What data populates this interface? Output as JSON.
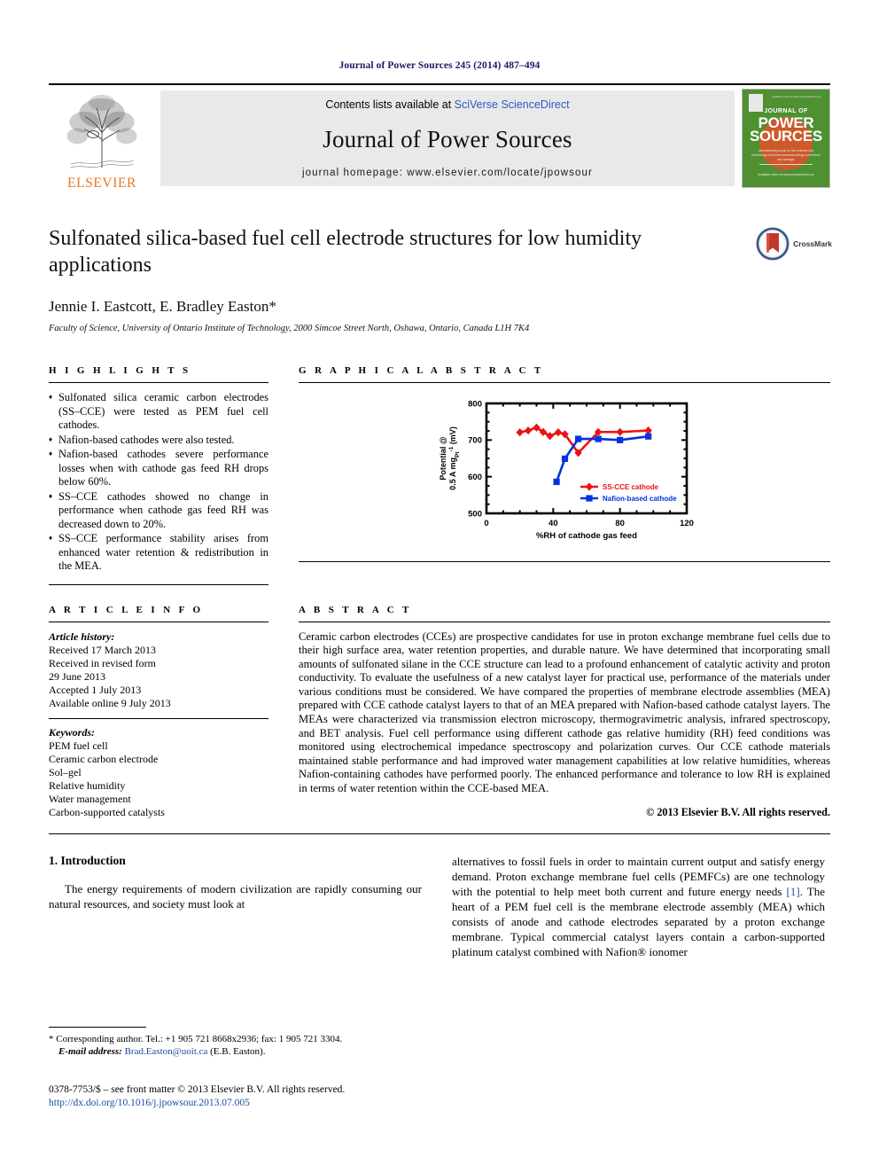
{
  "running_head": "Journal of Power Sources 245 (2014) 487–494",
  "masthead": {
    "contents_prefix": "Contents lists available at ",
    "contents_link": "SciVerse ScienceDirect",
    "journal_name": "Journal of Power Sources",
    "homepage": "journal homepage: www.elsevier.com/locate/jpowsour",
    "publisher": "ELSEVIER",
    "cover": {
      "line1": "JOURNAL OF",
      "line2": "POWER",
      "line3": "SOURCES",
      "subtitle": "International journal on the science and technology of electrochemical energy conversion and storage",
      "footer": "Available online at www.sciencedirect.com"
    }
  },
  "title": "Sulfonated silica-based fuel cell electrode structures for low humidity applications",
  "authors": "Jennie I. Eastcott, E. Bradley Easton*",
  "affiliation": "Faculty of Science, University of Ontario Institute of Technology, 2000 Simcoe Street North, Oshawa, Ontario, Canada L1H 7K4",
  "crossmark_label": "CrossMark",
  "highlights": {
    "heading": "H I G H L I G H T S",
    "items": [
      "Sulfonated silica ceramic carbon electrodes (SS–CCE) were tested as PEM fuel cell cathodes.",
      "Nafion-based cathodes were also tested.",
      "Nafion-based cathodes severe performance losses when with cathode gas feed RH drops below 60%.",
      "SS–CCE cathodes showed no change in performance when cathode gas feed RH was decreased down to 20%.",
      "SS–CCE performance stability arises from enhanced water retention & redistribution in the MEA."
    ]
  },
  "graphical_abstract": {
    "heading": "G R A P H I C A L   A B S T R A C T"
  },
  "article_info": {
    "heading": "A R T I C L E   I N F O",
    "history_title": "Article history:",
    "history": [
      "Received 17 March 2013",
      "Received in revised form",
      "29 June 2013",
      "Accepted 1 July 2013",
      "Available online 9 July 2013"
    ],
    "keywords_title": "Keywords:",
    "keywords": [
      "PEM fuel cell",
      "Ceramic carbon electrode",
      "Sol–gel",
      "Relative humidity",
      "Water management",
      "Carbon-supported catalysts"
    ]
  },
  "abstract": {
    "heading": "A B S T R A C T",
    "text": "Ceramic carbon electrodes (CCEs) are prospective candidates for use in proton exchange membrane fuel cells due to their high surface area, water retention properties, and durable nature. We have determined that incorporating small amounts of sulfonated silane in the CCE structure can lead to a profound enhancement of catalytic activity and proton conductivity. To evaluate the usefulness of a new catalyst layer for practical use, performance of the materials under various conditions must be considered. We have compared the properties of membrane electrode assemblies (MEA) prepared with CCE cathode catalyst layers to that of an MEA prepared with Nafion-based cathode catalyst layers. The MEAs were characterized via transmission electron microscopy, thermogravimetric analysis, infrared spectroscopy, and BET analysis. Fuel cell performance using different cathode gas relative humidity (RH) feed conditions was monitored using electrochemical impedance spectroscopy and polarization curves. Our CCE cathode materials maintained stable performance and had improved water management capabilities at low relative humidities, whereas Nafion-containing cathodes have performed poorly. The enhanced performance and tolerance to low RH is explained in terms of water retention within the CCE-based MEA.",
    "copyright": "© 2013 Elsevier B.V. All rights reserved."
  },
  "introduction": {
    "heading": "1.  Introduction",
    "left_paragraph": "The energy requirements of modern civilization are rapidly consuming our natural resources, and society must look at",
    "right_paragraph_a": "alternatives to fossil fuels in order to maintain current output and satisfy energy demand. Proton exchange membrane fuel cells (PEMFCs) are one technology with the potential to help meet both current and future energy needs ",
    "right_ref": "[1]",
    "right_paragraph_b": ". The heart of a PEM fuel cell is the membrane electrode assembly (MEA) which consists of anode and cathode electrodes separated by a proton exchange membrane. Typical commercial catalyst layers contain a carbon-supported platinum catalyst combined with Nafion® ionomer"
  },
  "footnotes": {
    "corresponding": "* Corresponding author. Tel.: +1 905 721 8668x2936; fax: 1 905 721 3304.",
    "email_label": "E-mail address:",
    "email": "Brad.Easton@uoit.ca",
    "email_suffix": "(E.B. Easton).",
    "issn_line": "0378-7753/$ – see front matter © 2013 Elsevier B.V. All rights reserved.",
    "doi": "http://dx.doi.org/10.1016/j.jpowsour.2013.07.005"
  },
  "chart_data": {
    "type": "line",
    "title": "",
    "xlabel": "%RH of cathode gas feed",
    "ylabel": "Potential @ 0.5 A mgₚₜ⁻¹ (mV)",
    "ylabel_line1": "Potential @",
    "ylabel_line2": "0.5 A mg",
    "ylabel_sub": "Pt",
    "ylabel_sup": "-1",
    "ylabel_line3": " (mV)",
    "xlim": [
      0,
      120
    ],
    "ylim": [
      500,
      800
    ],
    "xticks": [
      0,
      40,
      80,
      120
    ],
    "xtick_labels": [
      "0",
      "40",
      "80",
      "120"
    ],
    "yticks": [
      500,
      600,
      700,
      800
    ],
    "ytick_labels": [
      "500",
      "600",
      "700",
      "800"
    ],
    "x_minor_interval": 10,
    "y_minor_interval": 25,
    "grid": false,
    "legend_position": "bottom-right",
    "series": [
      {
        "name": "SS-CCE cathode",
        "color": "#ee1111",
        "marker": "diamond",
        "x": [
          20,
          25,
          30,
          34,
          38,
          43,
          47,
          55,
          67,
          80,
          97
        ],
        "y": [
          721,
          726,
          734,
          722,
          711,
          721,
          716,
          665,
          722,
          722,
          726
        ]
      },
      {
        "name": "Nafion-based cathode",
        "color": "#0033dd",
        "marker": "square",
        "x": [
          42,
          47,
          55,
          67,
          80,
          97
        ],
        "y": [
          586,
          649,
          703,
          703,
          700,
          710
        ]
      }
    ]
  }
}
